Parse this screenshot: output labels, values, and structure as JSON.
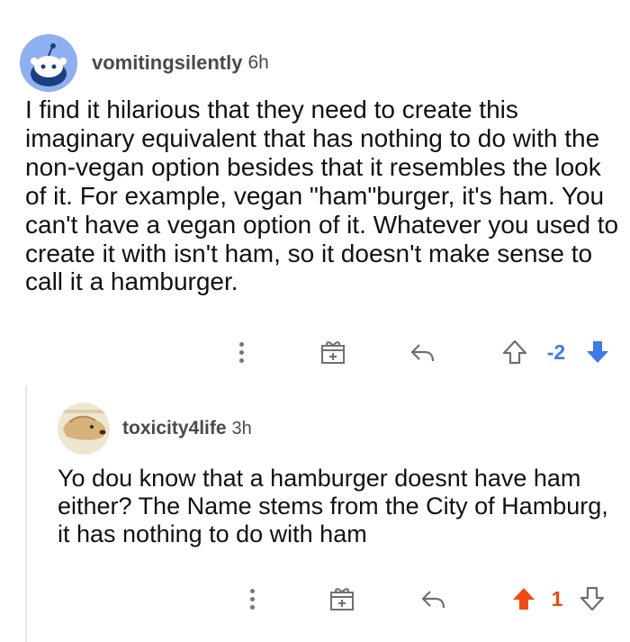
{
  "comments": [
    {
      "username": "vomitingsilently",
      "age": "6h",
      "text": "I find it hilarious that they need to create this imaginary equivalent that has nothing to do with the non-vegan option besides that it resembles the look of it. For example, vegan \"ham\"burger, it's ham. You can't have a vegan option of it. Whatever you used to create it with isn't ham, so it doesn't make sense to call it a hamburger.",
      "score": "-2",
      "vote_state": "downvoted",
      "avatar_icon": "snoo-avatar-icon"
    },
    {
      "username": "toxicity4life",
      "age": "3h",
      "text": "Yo dou know that a hamburger doesnt have ham either? The Name stems from the City of Hamburg, it has nothing to do with ham",
      "score": "1",
      "vote_state": "upvoted",
      "avatar_icon": "dog-avatar-icon"
    }
  ],
  "colors": {
    "downvote": "#3d7be6",
    "upvote": "#ee4b12",
    "icon_gray": "#6f6f6f",
    "avatar_blue": "#8fb0ee"
  }
}
